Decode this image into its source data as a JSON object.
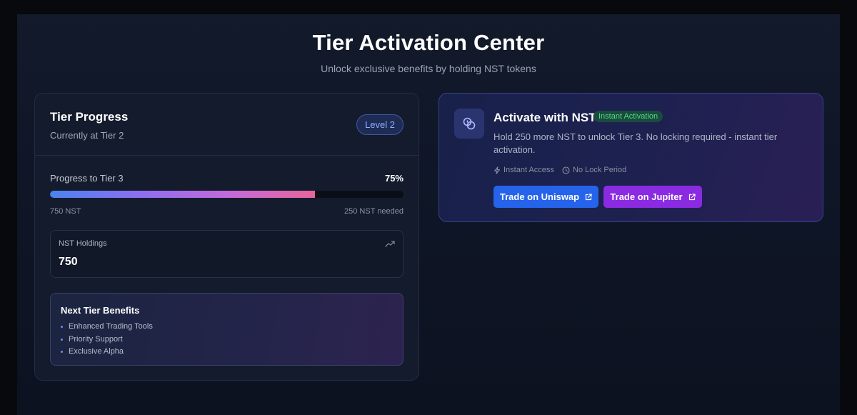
{
  "header": {
    "title": "Tier Activation Center",
    "subtitle": "Unlock exclusive benefits by holding NST tokens"
  },
  "tier_progress": {
    "title": "Tier Progress",
    "current_tier_text": "Currently at Tier 2",
    "level_badge": "Level 2",
    "progress_label": "Progress to Tier 3",
    "progress_percent_text": "75%",
    "progress_fraction": 0.75,
    "current_amount": "750 NST",
    "needed_amount": "250 NST needed"
  },
  "holdings": {
    "label": "NST Holdings",
    "value": "750",
    "icon": "trending-up-icon"
  },
  "benefits": {
    "title": "Next Tier Benefits",
    "items": [
      "Enhanced Trading Tools",
      "Priority Support",
      "Exclusive Alpha"
    ]
  },
  "activate": {
    "icon": "coins-icon",
    "title": "Activate with NST",
    "badge": "Instant Activation",
    "description": "Hold 250 more NST to unlock Tier 3. No locking required - instant tier activation.",
    "features": [
      {
        "label": "Instant Access",
        "icon": "lightning-icon"
      },
      {
        "label": "No Lock Period",
        "icon": "clock-icon"
      }
    ],
    "buttons": {
      "uniswap": "Trade on Uniswap",
      "jupiter": "Trade on Jupiter"
    }
  },
  "colors": {
    "page_bg": "#07090d",
    "card_bg": "#131b2c",
    "accent_blue": "#2563eb",
    "accent_purple": "#8a2be2",
    "success_green": "#4ade80",
    "level_badge_text": "#8fb0ff"
  }
}
